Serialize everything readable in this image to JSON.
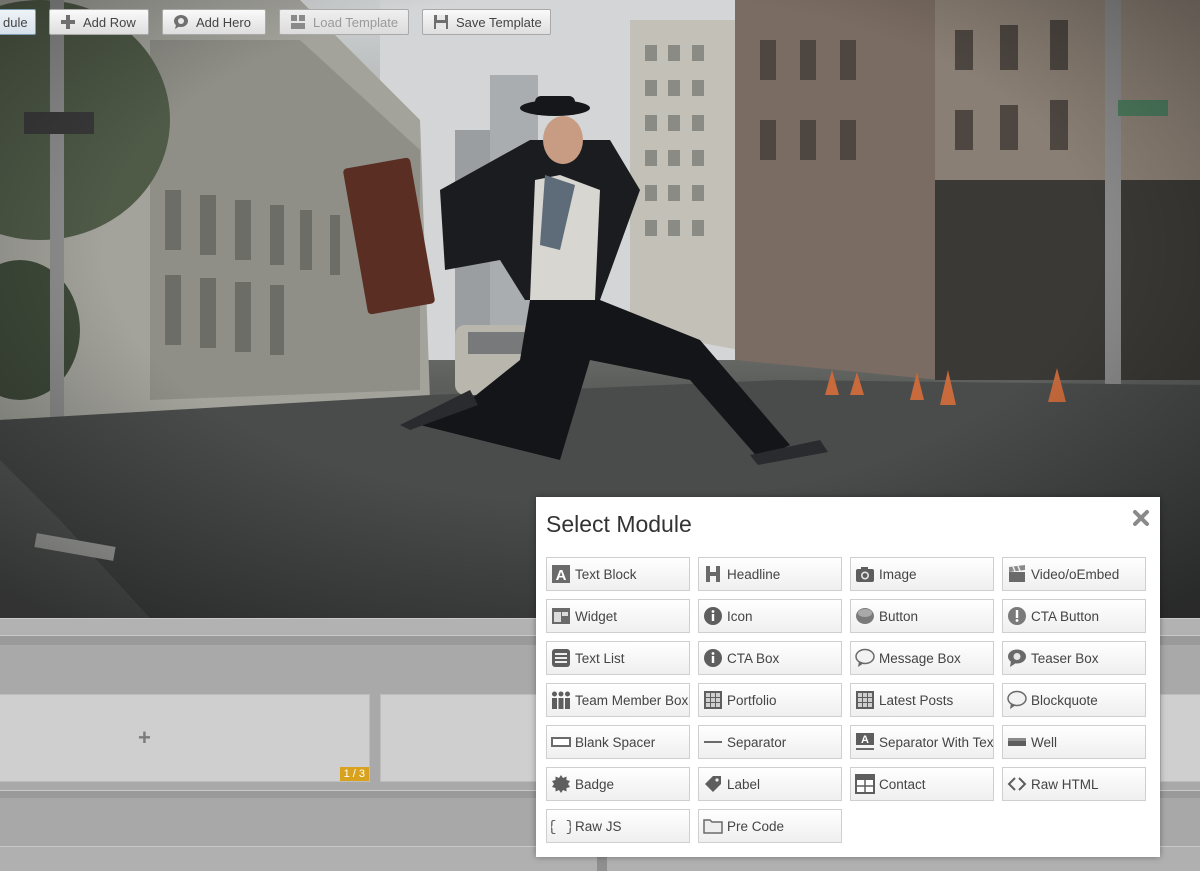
{
  "toolbar": {
    "add_module_label": "dule",
    "add_row_label": "Add Row",
    "add_hero_label": "Add Hero",
    "load_template_label": "Load Template",
    "save_template_label": "Save Template"
  },
  "builder": {
    "column_size_badge": "1 / 3"
  },
  "modal": {
    "title": "Select Module",
    "modules": [
      {
        "label": "Text Block",
        "icon": "text-block-icon"
      },
      {
        "label": "Headline",
        "icon": "headline-icon"
      },
      {
        "label": "Image",
        "icon": "camera-icon"
      },
      {
        "label": "Video/oEmbed",
        "icon": "clapperboard-icon"
      },
      {
        "label": "Widget",
        "icon": "widget-icon"
      },
      {
        "label": "Icon",
        "icon": "info-icon"
      },
      {
        "label": "Button",
        "icon": "button-icon"
      },
      {
        "label": "CTA Button",
        "icon": "cta-button-icon"
      },
      {
        "label": "Text List",
        "icon": "list-icon"
      },
      {
        "label": "CTA Box",
        "icon": "info-icon"
      },
      {
        "label": "Message Box",
        "icon": "speech-bubble-icon"
      },
      {
        "label": "Teaser Box",
        "icon": "teaser-icon"
      },
      {
        "label": "Team Member Box",
        "icon": "team-icon"
      },
      {
        "label": "Portfolio",
        "icon": "grid-icon"
      },
      {
        "label": "Latest Posts",
        "icon": "grid-icon"
      },
      {
        "label": "Blockquote",
        "icon": "speech-bubble-icon"
      },
      {
        "label": "Blank Spacer",
        "icon": "spacer-icon"
      },
      {
        "label": "Separator",
        "icon": "separator-icon"
      },
      {
        "label": "Separator With Text",
        "icon": "separator-text-icon"
      },
      {
        "label": "Well",
        "icon": "well-icon"
      },
      {
        "label": "Badge",
        "icon": "badge-icon"
      },
      {
        "label": "Label",
        "icon": "tag-icon"
      },
      {
        "label": "Contact",
        "icon": "table-icon"
      },
      {
        "label": "Raw HTML",
        "icon": "code-icon"
      },
      {
        "label": "Raw JS",
        "icon": "braces-icon"
      },
      {
        "label": "Pre Code",
        "icon": "folder-icon"
      }
    ]
  }
}
